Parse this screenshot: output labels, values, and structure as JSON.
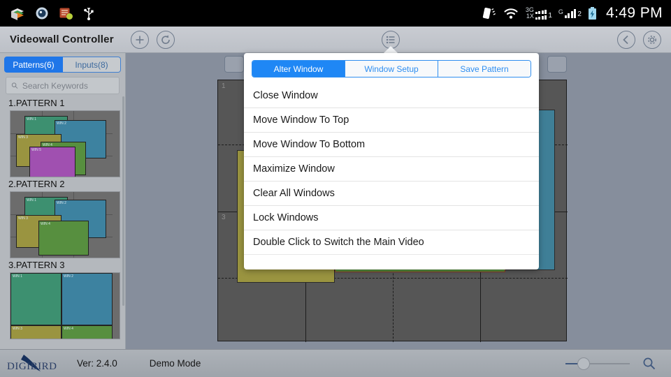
{
  "status_bar": {
    "icons_left": [
      "books-icon",
      "camera-shutter-icon",
      "notes-icon",
      "usb-icon"
    ],
    "vibrate_icon": "vibrate-icon",
    "wifi_icon": "wifi-icon",
    "signal1": {
      "tech_top": "3G",
      "tech_bottom": "1X",
      "sim": "1"
    },
    "signal2": {
      "tech": "G",
      "sim": "2"
    },
    "battery_icon": "battery-charging-icon",
    "time": "4:49 PM"
  },
  "titlebar": {
    "title": "Videowall Controller",
    "add_icon": "plus-circle-icon",
    "refresh_icon": "refresh-circle-icon",
    "menu_icon": "list-menu-icon",
    "back_icon": "back-chevron-icon",
    "settings_icon": "gear-icon"
  },
  "sidebar": {
    "tabs": [
      {
        "label": "Patterns(6)",
        "active": true
      },
      {
        "label": "Inputs(8)",
        "active": false
      }
    ],
    "search": {
      "placeholder": "Search Keywords",
      "value": "",
      "icon": "search-icon"
    },
    "patterns": [
      {
        "label": "1.PATTERN 1"
      },
      {
        "label": "2.PATTERN 2"
      },
      {
        "label": "3.PATTERN 3"
      }
    ]
  },
  "popup": {
    "segments": [
      {
        "label": "Alter Window",
        "active": true
      },
      {
        "label": "Window Setup",
        "active": false
      },
      {
        "label": "Save Pattern",
        "active": false
      }
    ],
    "items": [
      {
        "label": "Close Window"
      },
      {
        "label": "Move Window To Top"
      },
      {
        "label": "Move Window To Bottom"
      },
      {
        "label": "Maximize Window"
      },
      {
        "label": "Clear All Windows"
      },
      {
        "label": "Lock Windows"
      },
      {
        "label": "Double Click to Switch the Main Video"
      }
    ]
  },
  "wall": {
    "cell_labels": [
      "1",
      "3"
    ],
    "windows": [
      {
        "name": "teal-window",
        "color": "#3f7f97"
      },
      {
        "name": "olive-window",
        "color": "#9a9440"
      },
      {
        "name": "green-window",
        "color": "#578f3f"
      }
    ]
  },
  "bottombar": {
    "brand": "DIGIBIRD",
    "version": "Ver: 2.4.0",
    "mode": "Demo Mode",
    "zoom_icon": "magnifier-icon"
  },
  "colors": {
    "accent": "#1f87f5",
    "bg": "#868e9c",
    "wall_bg": "#565656",
    "thumb_teal_green": "#3d9070",
    "thumb_blue": "#3d82a0",
    "thumb_olive": "#9a9440",
    "thumb_green": "#578f3f",
    "thumb_purple": "#a050b0"
  }
}
